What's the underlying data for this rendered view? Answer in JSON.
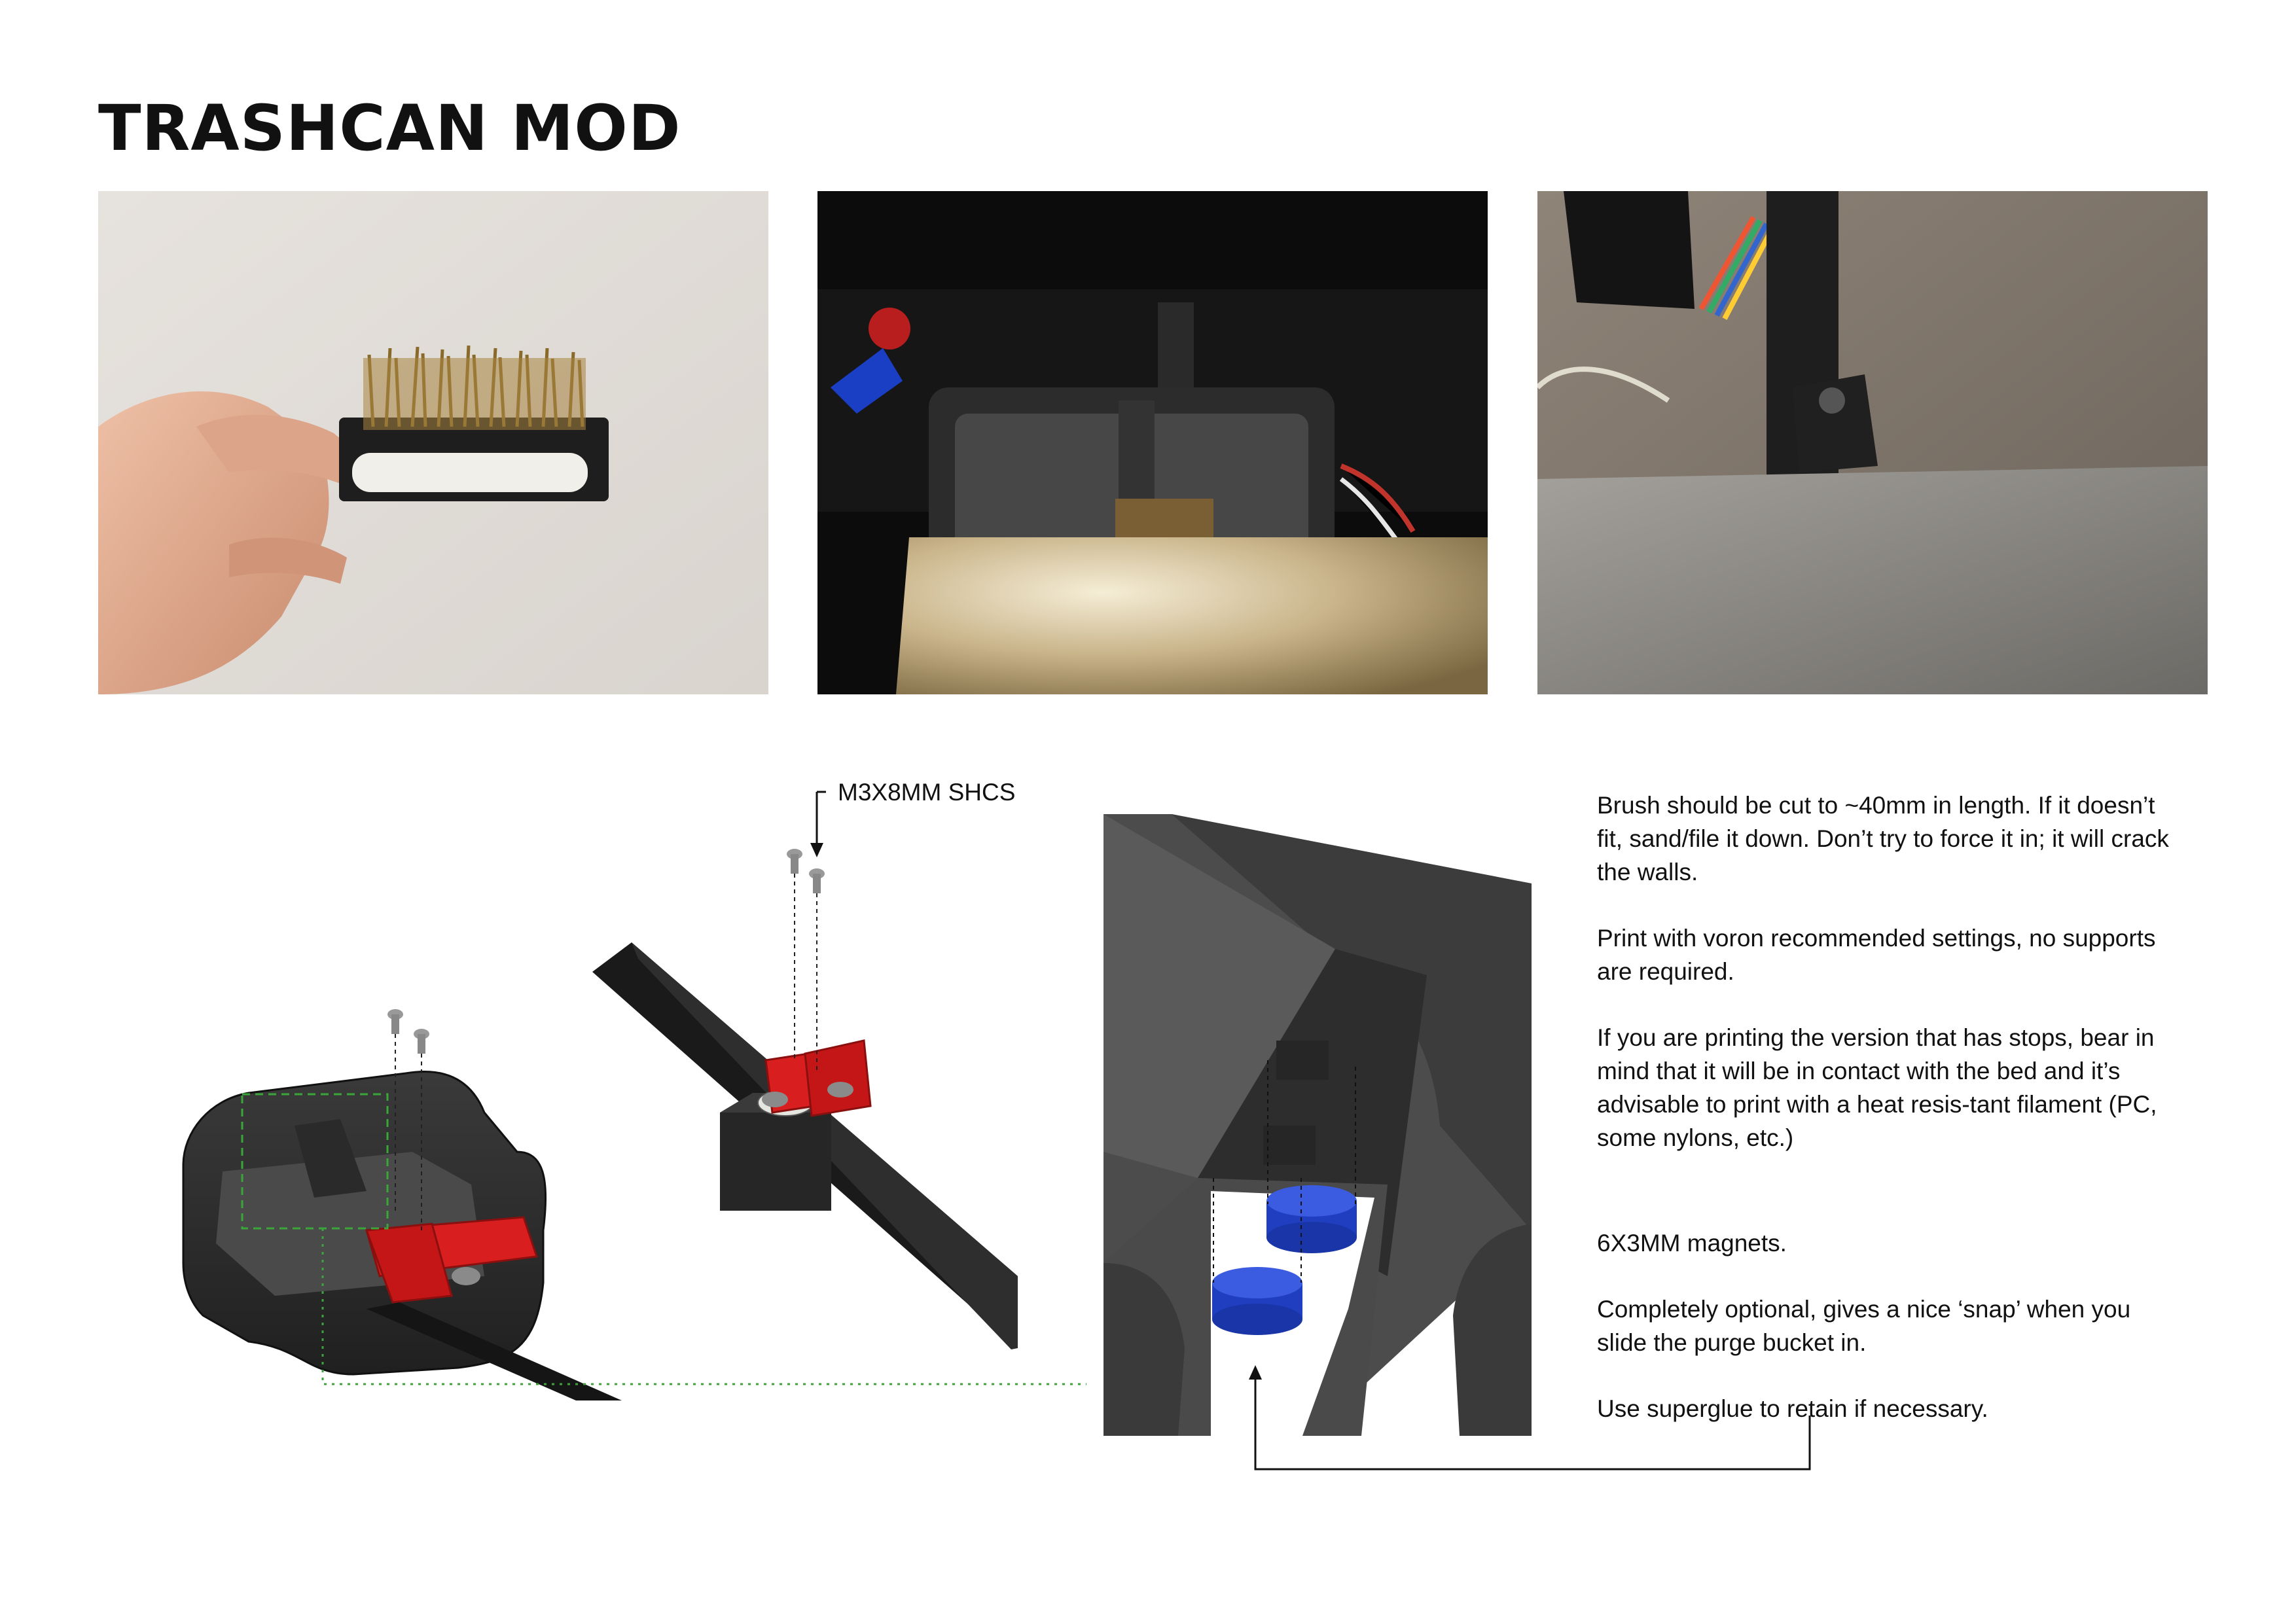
{
  "title": "TRASHCAN MOD",
  "annotations": {
    "screw_label": "M3X8MM SHCS"
  },
  "notes": [
    "Brush should be cut to ~40mm in length. If it doesn’t fit, sand/file it down. Don’t try to force it in; it will crack the walls.",
    "Print with voron recommended settings, no supports are required.",
    "If you are printing the version that has stops, bear in mind that it will be in contact with the bed and it’s advisable to print with a heat resis-tant filament (PC, some nylons, etc.)",
    "6X3MM magnets.",
    "Completely optional, gives a nice ‘snap’ when you slide the purge bucket in.",
    "Use superglue to retain if necessary."
  ],
  "colors": {
    "part_red": "#e01b1b",
    "part_black": "#2b2b2b",
    "magnet_blue": "#1f3fc0",
    "guide_green": "#3aa63a"
  },
  "photos": [
    {
      "icon": "hand-holding-brush-photo"
    },
    {
      "icon": "printer-bed-bucket-photo"
    },
    {
      "icon": "bed-stop-closeup-photo"
    }
  ]
}
